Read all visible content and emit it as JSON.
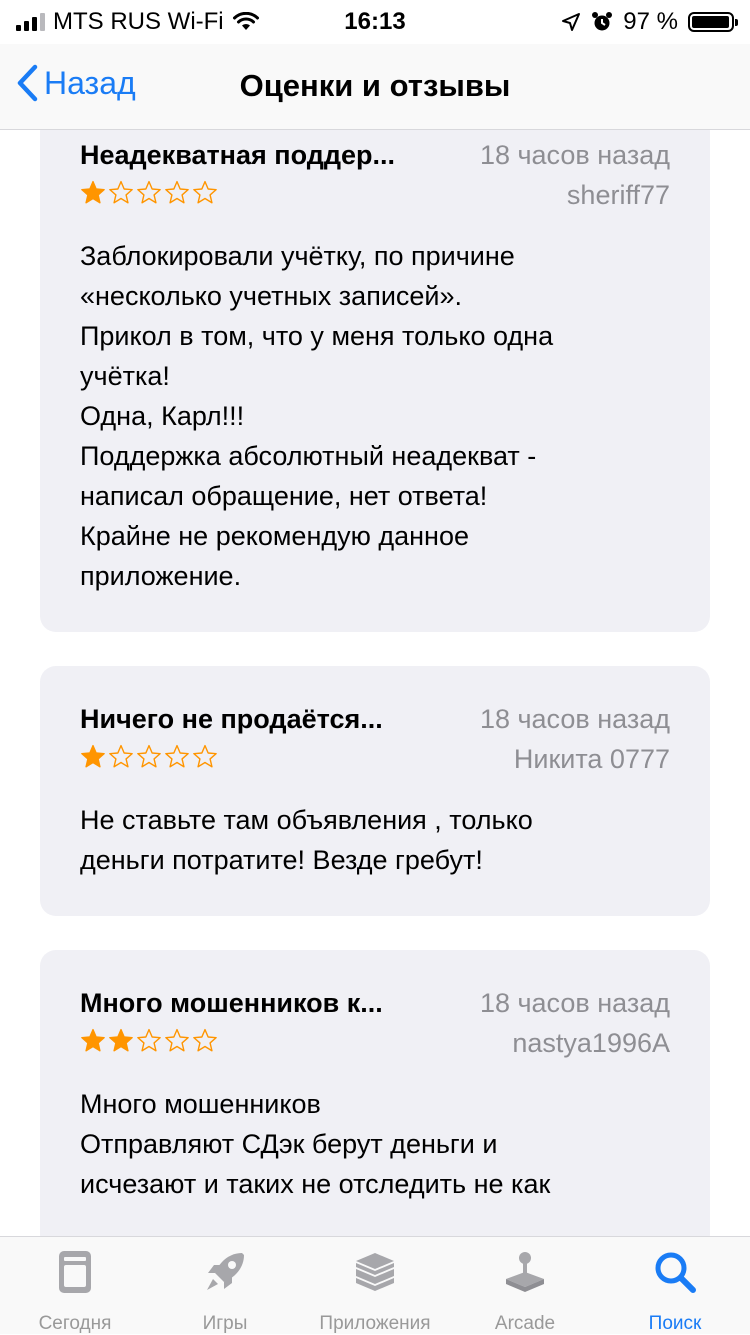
{
  "status_bar": {
    "carrier": "MTS RUS Wi-Fi",
    "time": "16:13",
    "battery": "97 %",
    "battery_level": 0.97
  },
  "nav": {
    "back_label": "Назад",
    "title": "Оценки и отзывы"
  },
  "reviews": [
    {
      "title": "Неадекватная поддер...",
      "date": "18 часов назад",
      "author": "sheriff77",
      "rating": 1,
      "body": [
        "Заблокировали учётку, по причине",
        "«несколько учетных записей».",
        "Прикол в том, что у меня только одна",
        "учётка!",
        "Одна, Карл!!!",
        "Поддержка абсолютный неадекват -",
        "написал обращение, нет ответа!",
        "Крайне не рекомендую данное",
        "приложение."
      ]
    },
    {
      "title": "Ничего не продаётся...",
      "date": "18 часов назад",
      "author": "Никита 0777",
      "rating": 1,
      "body": [
        "Не ставьте там объявления , только",
        "деньги потратите! Везде гребут!"
      ]
    },
    {
      "title": "Много мошенников к...",
      "date": "18 часов назад",
      "author": "nastya1996A",
      "rating": 2,
      "body": [
        "Много мошенников",
        "Отправляют СДэк берут деньги и",
        "исчезают и таких не отследить не как"
      ]
    }
  ],
  "tabs": [
    {
      "label": "Сегодня",
      "icon": "today-icon"
    },
    {
      "label": "Игры",
      "icon": "rocket-icon"
    },
    {
      "label": "Приложения",
      "icon": "apps-stack-icon"
    },
    {
      "label": "Arcade",
      "icon": "joystick-icon"
    },
    {
      "label": "Поиск",
      "icon": "search-icon",
      "active": true
    }
  ],
  "colors": {
    "accent": "#1a7cf5",
    "star": "#ff9500",
    "card_bg": "#f0f0f5",
    "secondary_text": "#8e8e93"
  }
}
